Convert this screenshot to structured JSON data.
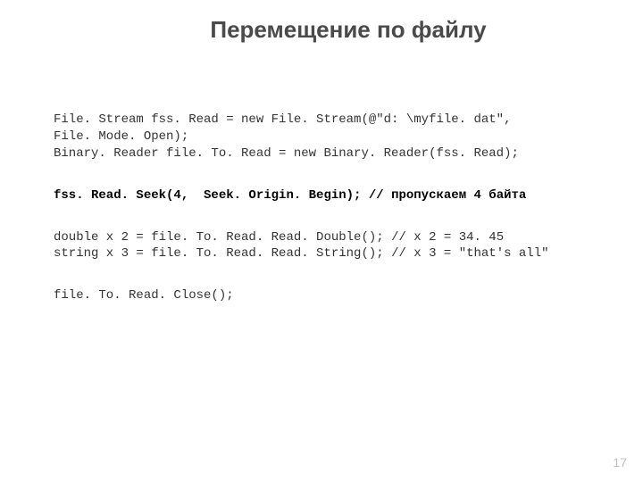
{
  "title": "Перемещение по файлу",
  "block1": {
    "l1": "File. Stream fss. Read = new File. Stream(@\"d: \\myfile. dat\",",
    "l2": "File. Mode. Open);",
    "l3": "Binary. Reader file. To. Read = new Binary. Reader(fss. Read);"
  },
  "seek": {
    "call": "fss. Read. Seek(4,  Seek. Origin. Begin);",
    "comment": "// пропускаем 4 байта"
  },
  "reads": {
    "l1_call": "double x 2 = file. To. Read. Read. Double();",
    "l1_comment": "// x 2 = 34. 45",
    "l2_call": "string x 3 = file. To. Read. Read. String();",
    "l2_comment": "// x 3 = \"that's all\""
  },
  "close": "file. To. Read. Close();",
  "page": "17"
}
